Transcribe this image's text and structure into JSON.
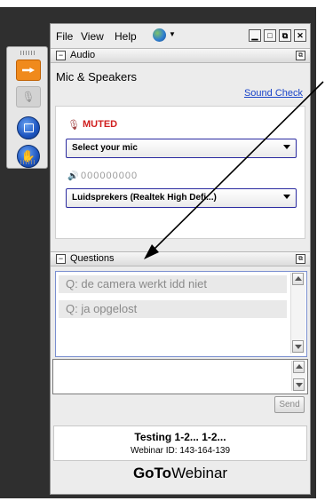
{
  "menu": {
    "file": "File",
    "view": "View",
    "help": "Help"
  },
  "window_buttons": {
    "minimize": "▁",
    "maximize": "□",
    "popout": "⧉",
    "close": "✕"
  },
  "audio": {
    "section_title": "Audio",
    "mode": "Mic & Speakers",
    "sound_check": "Sound Check",
    "mute_status": "MUTED",
    "mic_select": "Select your mic",
    "level_meter": "000000000",
    "speaker_select": "Luidsprekers (Realtek High Defi...)"
  },
  "questions": {
    "section_title": "Questions",
    "items": [
      "Q: de camera werkt idd niet",
      "Q: ja opgelost"
    ],
    "input_value": "",
    "send_label": "Send"
  },
  "footer": {
    "webinar_title": "Testing 1-2... 1-2...",
    "webinar_id": "Webinar ID: 143-164-139",
    "brand_bold": "GoTo",
    "brand_light": "Webinar"
  },
  "icons": {
    "arrow": "arrow-right-icon",
    "mic": "microphone-icon",
    "screen": "screen-share-icon",
    "hand": "raise-hand-icon",
    "globe": "globe-icon",
    "speaker": "speaker-icon",
    "muted_mic": "muted-microphone-icon"
  },
  "colors": {
    "muted": "#d02020",
    "link": "#1a44c8",
    "accent_orange": "#f08a1c",
    "select_border": "#2a2aa0"
  }
}
